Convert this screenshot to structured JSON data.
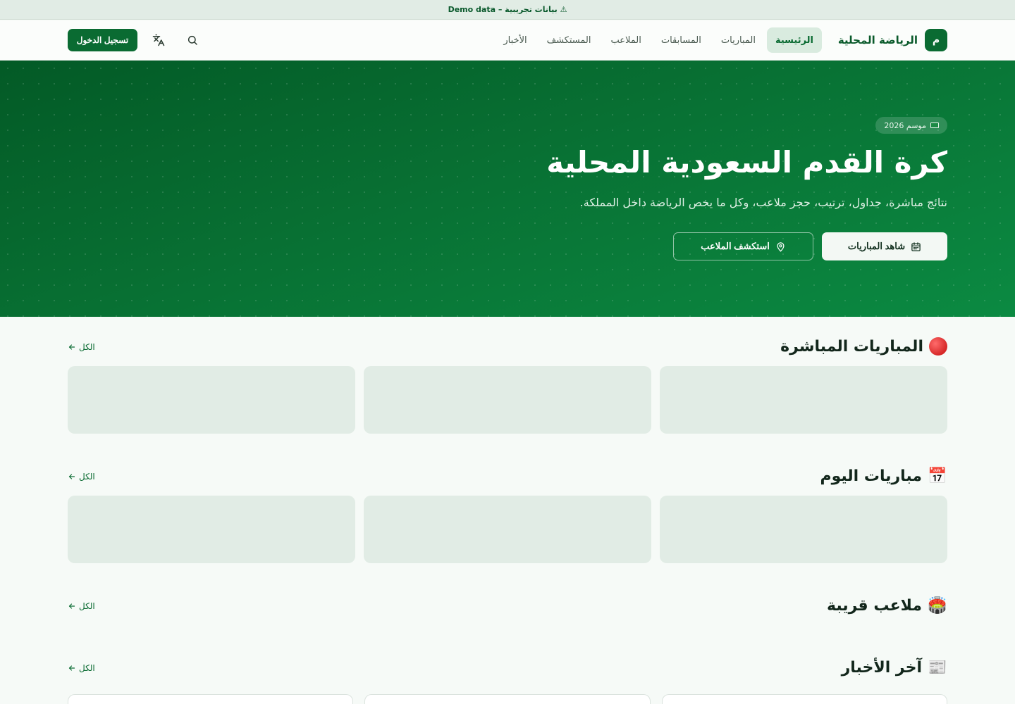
{
  "banner": {
    "text": "⚠ بيانات تجريبية – Demo data"
  },
  "brand": {
    "logo": "م",
    "name": "الرياضة المحلية"
  },
  "nav": [
    {
      "label": "الرئيسية",
      "active": true
    },
    {
      "label": "المباريات"
    },
    {
      "label": "المسابقات"
    },
    {
      "label": "الملاعب"
    },
    {
      "label": "المستكشف"
    },
    {
      "label": "الأخبار"
    }
  ],
  "header": {
    "login_label": "تسجيل الدخول",
    "search_icon": "search-icon",
    "translate_icon": "translate-icon"
  },
  "hero": {
    "badge": "موسم 2026",
    "title": "كرة القدم السعودية المحلية",
    "subtitle": "نتائج مباشرة، جداول، ترتيب، حجز ملاعب، وكل ما يخص الرياضة داخل المملكة.",
    "primary_cta": "شاهد المباريات",
    "secondary_cta": "استكشف الملاعب"
  },
  "sections": {
    "live": {
      "emoji": "🔴",
      "title": "المباريات المباشرة",
      "see_all": "الكل"
    },
    "today": {
      "emoji": "📅",
      "title": "مباريات اليوم",
      "see_all": "الكل"
    },
    "venues": {
      "emoji": "🏟️",
      "title": "ملاعب قريبة",
      "see_all": "الكل"
    },
    "news": {
      "emoji": "📰",
      "title": "آخر الأخبار",
      "see_all": "الكل"
    }
  },
  "colors": {
    "primary": "#0a6b32",
    "background": "#f6faf7",
    "card_placeholder": "#e1ece5"
  }
}
